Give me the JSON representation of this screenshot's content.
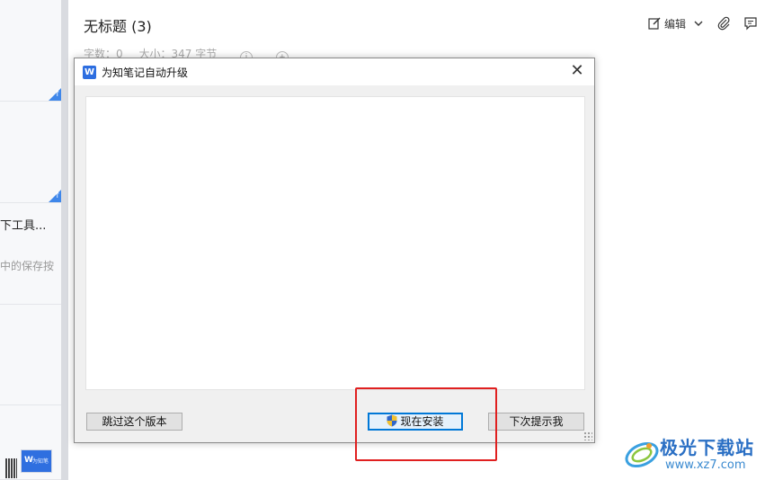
{
  "note_list": {
    "cards": [
      {},
      {},
      {
        "title": "下工具...",
        "snippet": "中的保存按"
      },
      {},
      {
        "thumb_logo": "W",
        "thumb_text": "为知笔"
      }
    ]
  },
  "editor": {
    "title": "无标题 (3)",
    "meta": {
      "word_count": "字数：0",
      "size": "大小：347 字节"
    },
    "toolbar": {
      "edit_label": "编辑"
    }
  },
  "dialog": {
    "title": "为知笔记自动升级",
    "app_icon_glyph": "W",
    "close_glyph": "✕",
    "buttons": {
      "skip": "跳过这个版本",
      "install": "现在安装",
      "later": "下次提示我"
    }
  },
  "watermark": {
    "name": "极光下载站",
    "url": "www.xz7.com"
  },
  "colors": {
    "accent_blue": "#2d6ee0",
    "highlight_red": "#e02020",
    "sync_badge": "#3f87ea"
  }
}
